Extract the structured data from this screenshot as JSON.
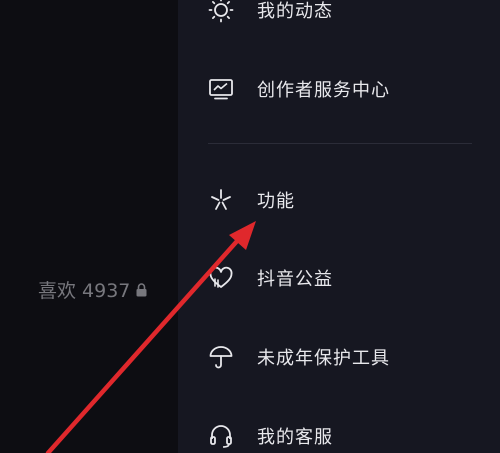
{
  "profile": {
    "likes_label": "喜欢 4937"
  },
  "menu": {
    "items": [
      {
        "label": "我的动态",
        "icon": "sun-icon"
      },
      {
        "label": "创作者服务中心",
        "icon": "monitor-chart-icon"
      },
      {
        "label": "功能",
        "icon": "sparkle-icon"
      },
      {
        "label": "抖音公益",
        "icon": "heart-icon"
      },
      {
        "label": "未成年保护工具",
        "icon": "umbrella-icon"
      },
      {
        "label": "我的客服",
        "icon": "headset-icon"
      }
    ]
  },
  "colors": {
    "drawer_bg": "#161721",
    "left_bg": "#0d0d12",
    "text": "#e8e8ec",
    "muted_text": "#77777d",
    "arrow": "#e0282c"
  }
}
